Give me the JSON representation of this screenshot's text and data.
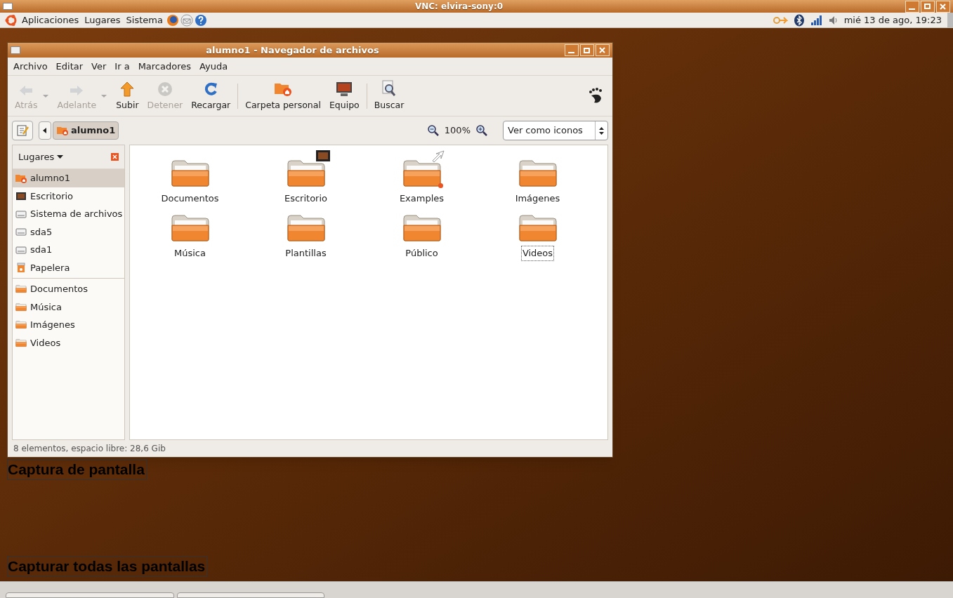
{
  "vnc_window": {
    "title": "VNC: elvira-sony:0"
  },
  "top_panel": {
    "menus": [
      "Aplicaciones",
      "Lugares",
      "Sistema"
    ],
    "clock": "mié 13 de ago, 19:23"
  },
  "file_manager": {
    "title": "alumno1 - Navegador de archivos",
    "menu": [
      "Archivo",
      "Editar",
      "Ver",
      "Ir a",
      "Marcadores",
      "Ayuda"
    ],
    "toolbar": [
      {
        "kind": "back",
        "label": "Atrás",
        "disabled": true,
        "dropdown": true
      },
      {
        "kind": "forward",
        "label": "Adelante",
        "disabled": true,
        "dropdown": true
      },
      {
        "kind": "up",
        "label": "Subir",
        "disabled": false,
        "dropdown": false
      },
      {
        "kind": "stop",
        "label": "Detener",
        "disabled": true,
        "dropdown": false
      },
      {
        "kind": "reload",
        "label": "Recargar",
        "disabled": false,
        "dropdown": false
      },
      {
        "kind": "separator"
      },
      {
        "kind": "home",
        "label": "Carpeta personal",
        "disabled": false,
        "dropdown": false
      },
      {
        "kind": "computer",
        "label": "Equipo",
        "disabled": false,
        "dropdown": false
      },
      {
        "kind": "separator"
      },
      {
        "kind": "search",
        "label": "Buscar",
        "disabled": false,
        "dropdown": false
      }
    ],
    "path": [
      "alumno1"
    ],
    "zoom": "100%",
    "view_select": "Ver como iconos",
    "sidebar": {
      "header": "Lugares",
      "places": [
        {
          "label": "alumno1",
          "kind": "home",
          "selected": true
        },
        {
          "label": "Escritorio",
          "kind": "desktop",
          "selected": false
        },
        {
          "label": "Sistema de archivos",
          "kind": "drive",
          "selected": false
        },
        {
          "label": "sda5",
          "kind": "drive",
          "selected": false
        },
        {
          "label": "sda1",
          "kind": "drive",
          "selected": false
        },
        {
          "label": "Papelera",
          "kind": "trash",
          "selected": false
        }
      ],
      "bookmarks": [
        {
          "label": "Documentos",
          "kind": "folder",
          "selected": false
        },
        {
          "label": "Música",
          "kind": "folder",
          "selected": false
        },
        {
          "label": "Imágenes",
          "kind": "folder",
          "selected": false
        },
        {
          "label": "Videos",
          "kind": "folder",
          "selected": false
        }
      ]
    },
    "files": [
      {
        "label": "Documentos",
        "kind": "folder",
        "selected": false
      },
      {
        "label": "Escritorio",
        "kind": "desktop_folder",
        "selected": false
      },
      {
        "label": "Examples",
        "kind": "link_folder",
        "selected": false
      },
      {
        "label": "Imágenes",
        "kind": "folder",
        "selected": false
      },
      {
        "label": "Música",
        "kind": "folder",
        "selected": false
      },
      {
        "label": "Plantillas",
        "kind": "folder",
        "selected": false
      },
      {
        "label": "Público",
        "kind": "folder",
        "selected": false
      },
      {
        "label": "Videos",
        "kind": "folder",
        "selected": true
      }
    ],
    "status": "8 elementos, espacio libre: 28,6 Gib"
  },
  "overlay_labels": [
    "Captura de pantalla",
    "Capturar todas las pantallas"
  ]
}
